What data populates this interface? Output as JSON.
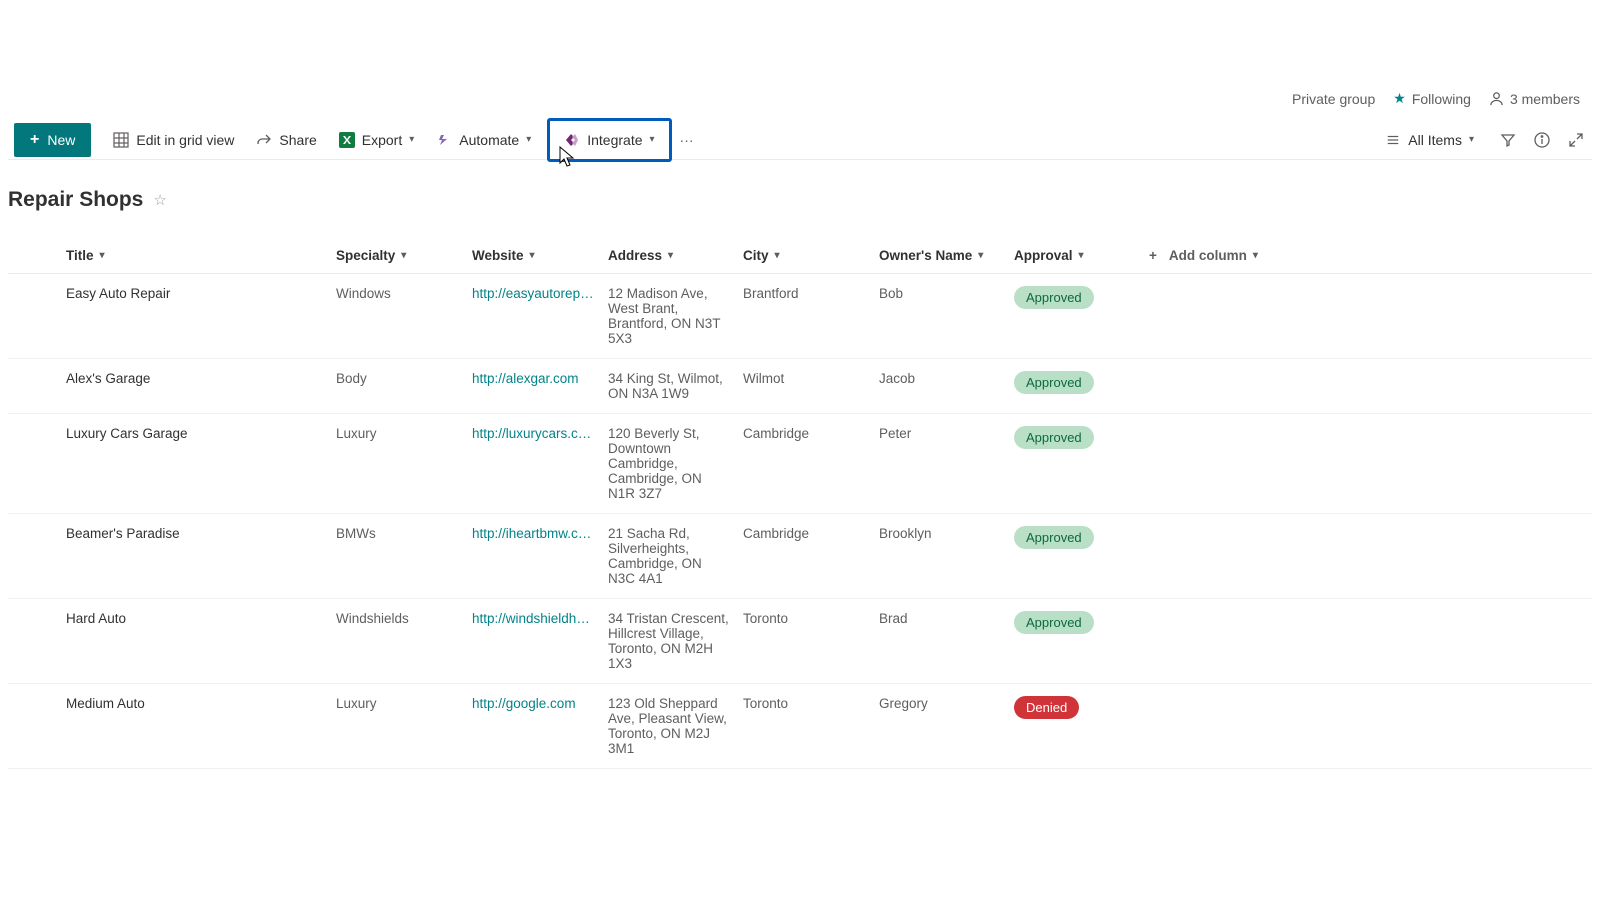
{
  "header": {
    "private_group": "Private group",
    "following": "Following",
    "members": "3 members"
  },
  "toolbar": {
    "new_label": "New",
    "edit_grid_label": "Edit in grid view",
    "share_label": "Share",
    "export_label": "Export",
    "automate_label": "Automate",
    "integrate_label": "Integrate",
    "all_items_label": "All Items"
  },
  "list": {
    "title": "Repair Shops"
  },
  "columns": {
    "title": "Title",
    "specialty": "Specialty",
    "website": "Website",
    "address": "Address",
    "city": "City",
    "owner": "Owner's Name",
    "approval": "Approval",
    "add_column": "Add column"
  },
  "rows": [
    {
      "title": "Easy Auto Repair",
      "specialty": "Windows",
      "website": "http://easyautorepair.c...",
      "address": "12 Madison Ave, West Brant, Brantford, ON N3T 5X3",
      "city": "Brantford",
      "owner": "Bob",
      "approval": "Approved",
      "approval_kind": "approved"
    },
    {
      "title": "Alex's Garage",
      "specialty": "Body",
      "website": "http://alexgar.com",
      "address": "34 King St, Wilmot, ON N3A 1W9",
      "city": "Wilmot",
      "owner": "Jacob",
      "approval": "Approved",
      "approval_kind": "approved"
    },
    {
      "title": "Luxury Cars Garage",
      "specialty": "Luxury",
      "website": "http://luxurycars.com",
      "address": "120 Beverly St, Downtown Cambridge, Cambridge, ON N1R 3Z7",
      "city": "Cambridge",
      "owner": "Peter",
      "approval": "Approved",
      "approval_kind": "approved"
    },
    {
      "title": "Beamer's Paradise",
      "specialty": "BMWs",
      "website": "http://iheartbmw.com",
      "address": "21 Sacha Rd, Silverheights, Cambridge, ON N3C 4A1",
      "city": "Cambridge",
      "owner": "Brooklyn",
      "approval": "Approved",
      "approval_kind": "approved"
    },
    {
      "title": "Hard Auto",
      "specialty": "Windshields",
      "website": "http://windshieldharda...",
      "address": "34 Tristan Crescent, Hillcrest Village, Toronto, ON M2H 1X3",
      "city": "Toronto",
      "owner": "Brad",
      "approval": "Approved",
      "approval_kind": "approved"
    },
    {
      "title": "Medium Auto",
      "specialty": "Luxury",
      "website": "http://google.com",
      "address": "123 Old Sheppard Ave, Pleasant View, Toronto, ON M2J 3M1",
      "city": "Toronto",
      "owner": "Gregory",
      "approval": "Denied",
      "approval_kind": "denied"
    }
  ]
}
